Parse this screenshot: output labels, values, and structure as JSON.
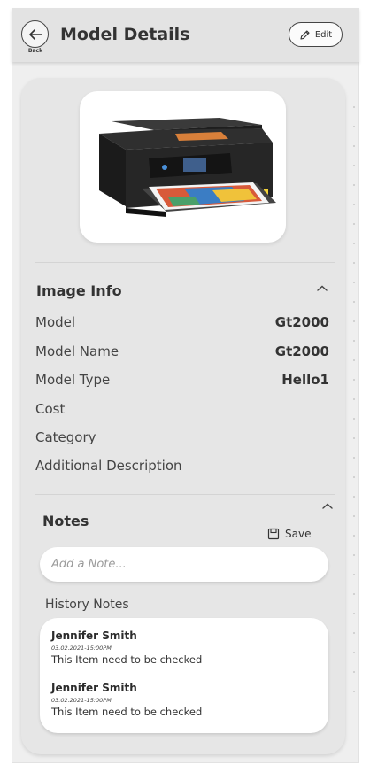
{
  "header": {
    "title": "Model Details",
    "back_label": "Back",
    "edit_label": "Edit"
  },
  "image_info": {
    "title": "Image Info",
    "rows": [
      {
        "label": "Model",
        "value": "Gt2000"
      },
      {
        "label": "Model Name",
        "value": "Gt2000"
      },
      {
        "label": "Model Type",
        "value": "Hello1"
      },
      {
        "label": "Cost",
        "value": ""
      },
      {
        "label": "Category",
        "value": ""
      },
      {
        "label": "Additional Description",
        "value": ""
      }
    ]
  },
  "notes": {
    "title": "Notes",
    "save_label": "Save",
    "input_placeholder": "Add a Note...",
    "history_label": "History Notes",
    "history": [
      {
        "name": "Jennifer Smith",
        "date": "03.02.2021-15:00PM",
        "text": "This Item need to be checked"
      },
      {
        "name": "Jennifer Smith",
        "date": "03.02.2021-15:00PM",
        "text": "This Item need to be checked"
      }
    ]
  },
  "colors": {
    "header_bg": "#e3e3e3",
    "card_bg": "#e6e6e6",
    "printer_body": "#2a2a2a"
  }
}
